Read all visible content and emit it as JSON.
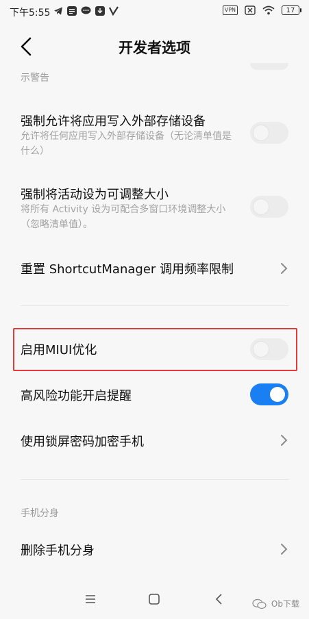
{
  "status_bar": {
    "time": "下午5:55",
    "left_icons": [
      "telegram-icon",
      "news-icon",
      "message-icon",
      "download-icon",
      "v-icon"
    ],
    "vpn_label": "VPN",
    "battery": "17"
  },
  "header": {
    "title": "开发者选项"
  },
  "partial_item": {
    "text": "示警告"
  },
  "settings": [
    {
      "title": "强制允许将应用写入外部存储设备",
      "subtitle": "允许将任何应用写入外部存储设备（无论清单值是什么）",
      "control": "toggle",
      "on": false
    },
    {
      "title": "强制将活动设为可调整大小",
      "subtitle": "将所有 Activity 设为可配合多窗口环境调整大小（忽略清单值）。",
      "control": "toggle",
      "on": false
    },
    {
      "title": "重置 ShortcutManager 调用频率限制",
      "control": "chevron"
    },
    {
      "title": "启用MIUI优化",
      "control": "toggle",
      "on": false,
      "highlighted": true
    },
    {
      "title": "高风险功能开启提醒",
      "control": "toggle",
      "on": true
    },
    {
      "title": "使用锁屏密码加密手机",
      "control": "chevron"
    }
  ],
  "section": {
    "header": "手机分身",
    "items": [
      {
        "title": "删除手机分身",
        "control": "chevron"
      }
    ]
  },
  "nav_bar": {
    "buttons": [
      "menu-icon",
      "home-icon",
      "back-icon"
    ]
  },
  "watermark": {
    "text": "Ob下载"
  },
  "colors": {
    "accent": "#1a7ff2",
    "highlight_border": "#e03a3a",
    "subtitle": "#a3a3a3",
    "background": "#f7f7f7"
  }
}
